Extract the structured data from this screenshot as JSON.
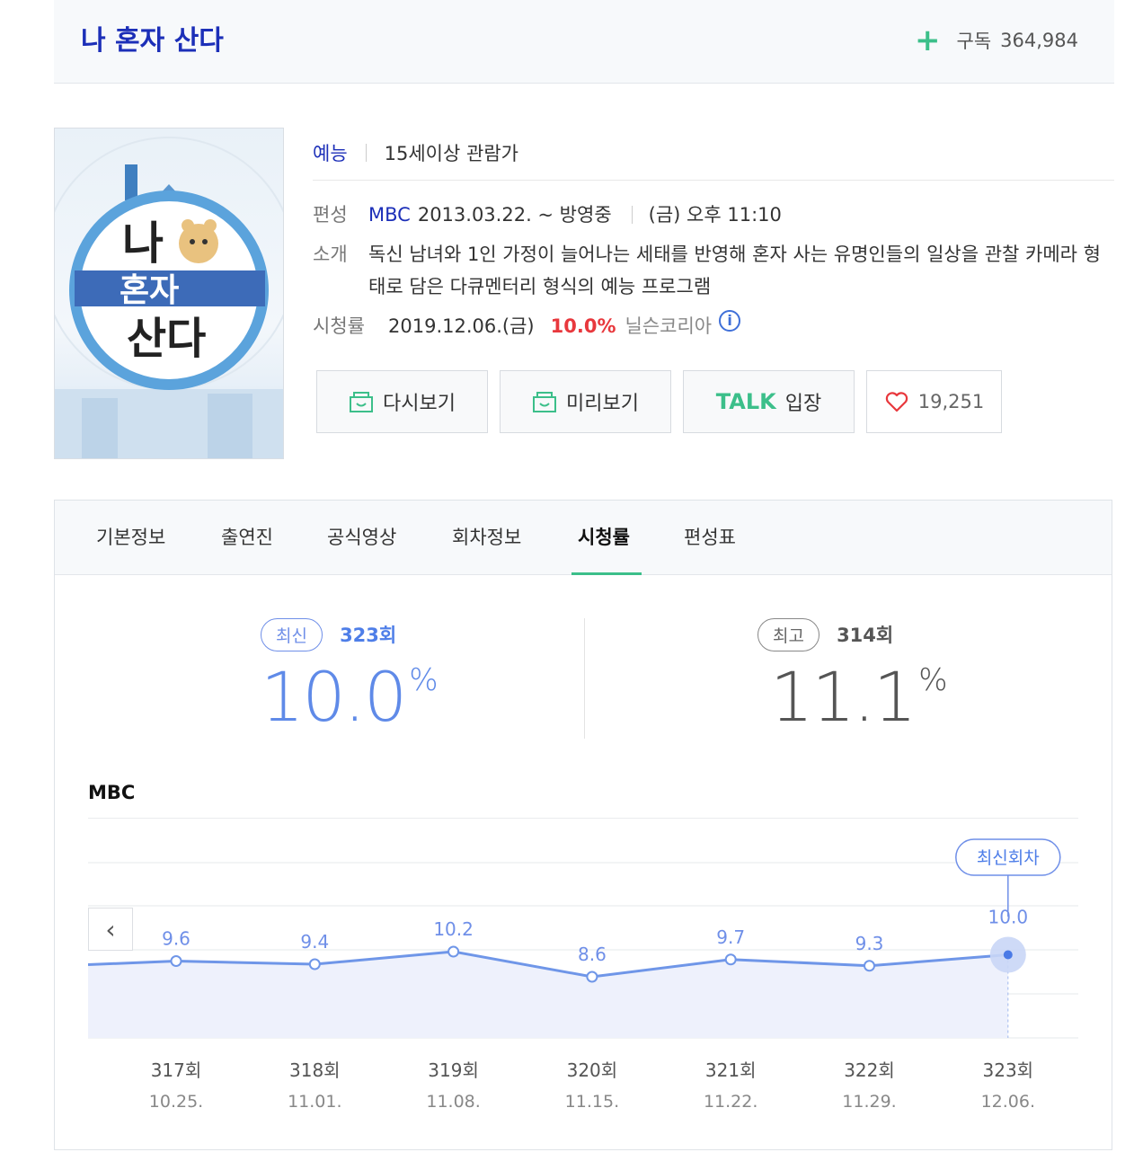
{
  "header": {
    "title": "나 혼자 산다",
    "subscribe_label": "구독",
    "subscribe_count": "364,984"
  },
  "info": {
    "genre": "예능",
    "rating_age": "15세이상 관람가",
    "schedule_label": "편성",
    "channel": "MBC",
    "period": "2013.03.22. ~ 방영중",
    "airtime": "(금) 오후 11:10",
    "intro_label": "소개",
    "intro_text": "독신 남녀와 1인 가정이 늘어나는 세태를 반영해 혼자 사는 유명인들의 일상을 관찰 카메라 형태로 담은 다큐멘터리 형식의 예능 프로그램",
    "viewership_label": "시청률",
    "viewership_date": "2019.12.06.(금)",
    "viewership_value": "10.0%",
    "viewership_source": "닐슨코리아"
  },
  "poster": {
    "line1": "나",
    "line2": "혼자",
    "line3": "산다"
  },
  "buttons": {
    "replay": "다시보기",
    "preview": "미리보기",
    "talk_brand": "TALK",
    "talk_label": "입장",
    "likes": "19,251"
  },
  "tabs": [
    "기본정보",
    "출연진",
    "공식영상",
    "회차정보",
    "시청률",
    "편성표"
  ],
  "stats": {
    "latest_label": "최신",
    "latest_ep": "323회",
    "latest_value": "10.0",
    "latest_unit": "%",
    "best_label": "최고",
    "best_ep": "314회",
    "best_value": "11.1",
    "best_unit": "%"
  },
  "chart_title": "MBC",
  "chart_data": {
    "type": "line",
    "categories": [
      "317회",
      "318회",
      "319회",
      "320회",
      "321회",
      "322회",
      "323회"
    ],
    "dates": [
      "10.25.",
      "11.01.",
      "11.08.",
      "11.15.",
      "11.22.",
      "11.29.",
      "12.06."
    ],
    "values": [
      9.6,
      9.4,
      10.2,
      8.6,
      9.7,
      9.3,
      10.0
    ],
    "latest_marker": "최신회차",
    "color": "#6f96e8"
  },
  "colors": {
    "brand": "#1c2fb8",
    "accent": "#3cbf8a",
    "highlight": "#e8383d",
    "line": "#6f96e8"
  },
  "icons": {
    "prev": "‹"
  }
}
